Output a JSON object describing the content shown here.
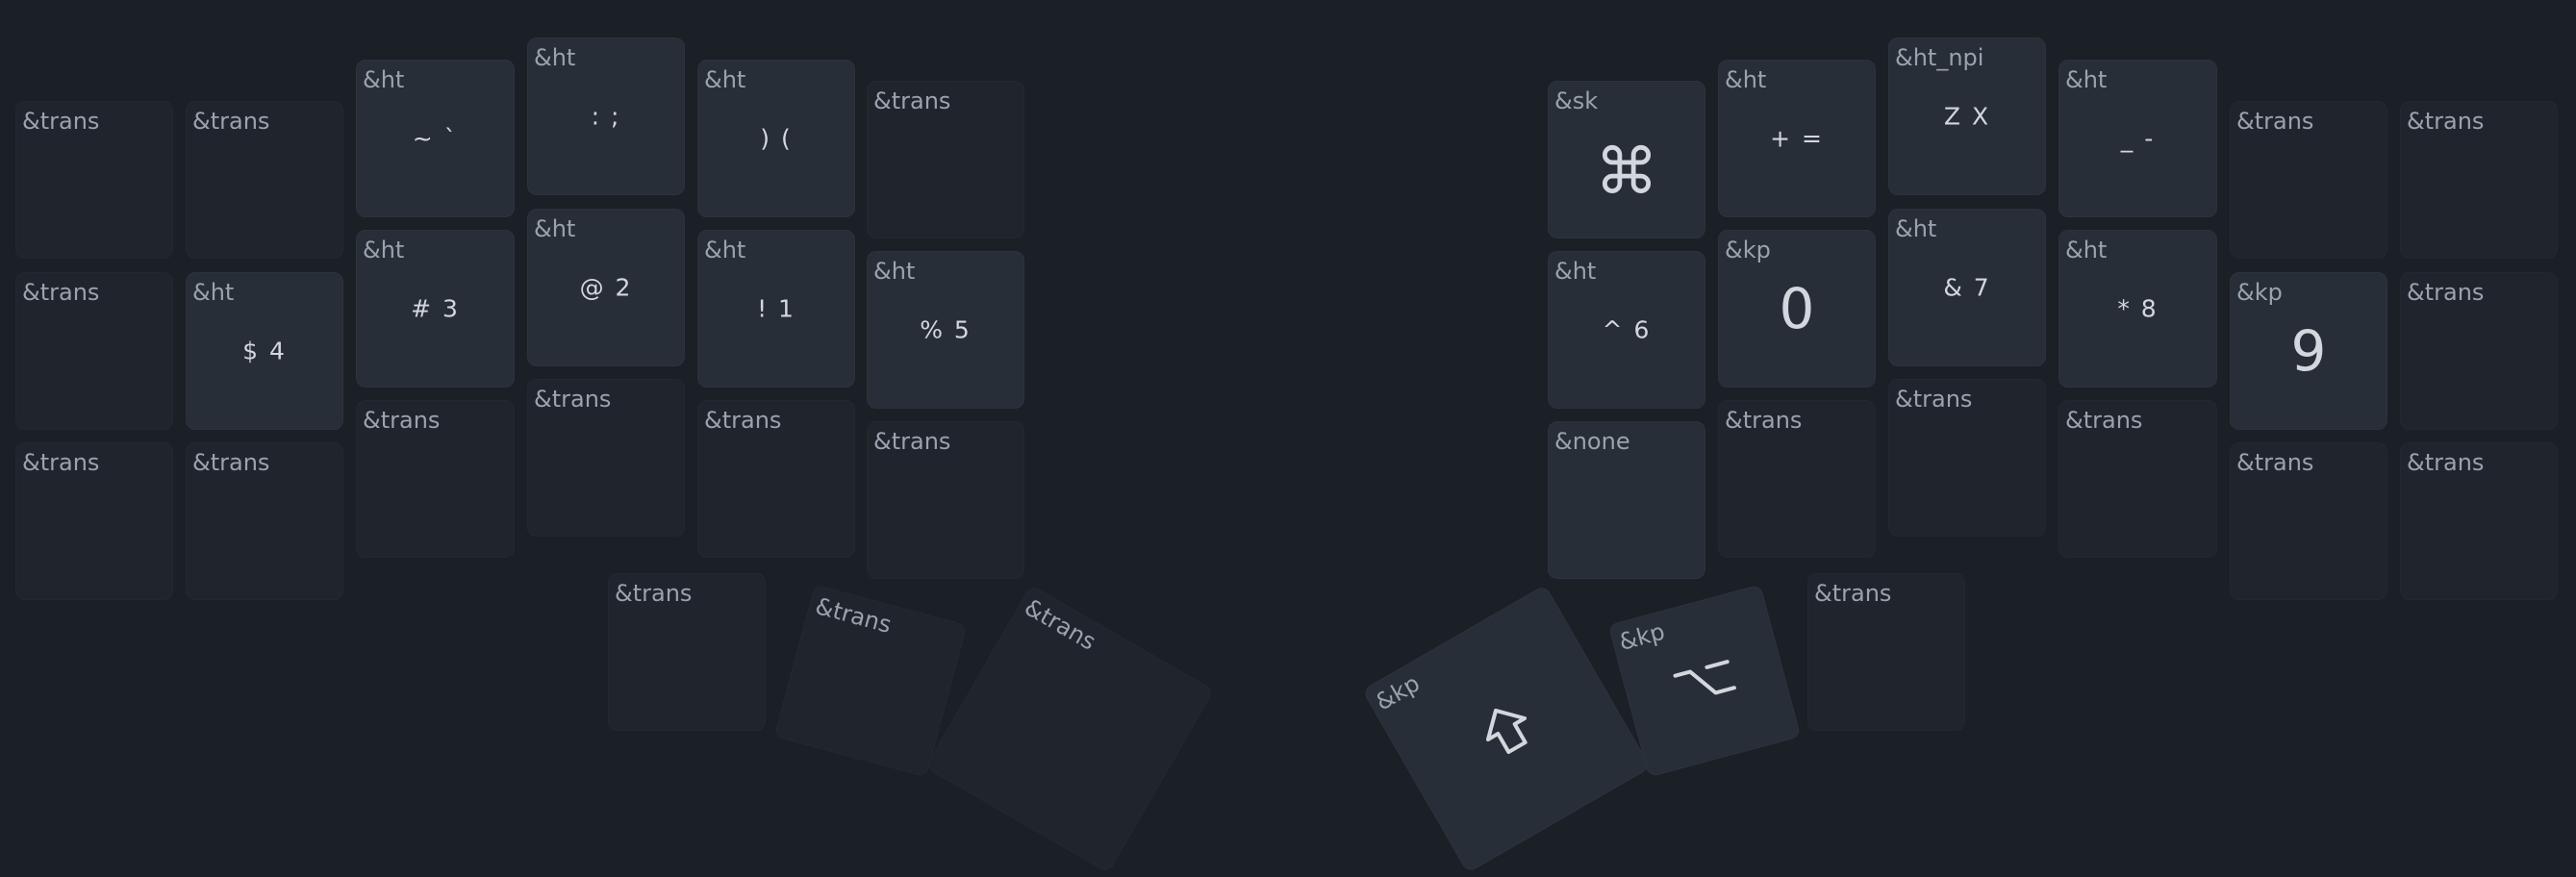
{
  "keys": [
    {
      "id": "l-r0-c0",
      "behavior": "&trans",
      "legend": ""
    },
    {
      "id": "l-r0-c1",
      "behavior": "&trans",
      "legend": ""
    },
    {
      "id": "l-r0-c2",
      "behavior": "&ht",
      "legend": "~ `"
    },
    {
      "id": "l-r0-c3",
      "behavior": "&ht",
      "legend": ": ;"
    },
    {
      "id": "l-r0-c4",
      "behavior": "&ht",
      "legend": ") ("
    },
    {
      "id": "l-r0-c5",
      "behavior": "&trans",
      "legend": ""
    },
    {
      "id": "l-r1-c0",
      "behavior": "&trans",
      "legend": ""
    },
    {
      "id": "l-r1-c1",
      "behavior": "&ht",
      "legend": "$ 4"
    },
    {
      "id": "l-r1-c2",
      "behavior": "&ht",
      "legend": "# 3"
    },
    {
      "id": "l-r1-c3",
      "behavior": "&ht",
      "legend": "@ 2"
    },
    {
      "id": "l-r1-c4",
      "behavior": "&ht",
      "legend": "! 1"
    },
    {
      "id": "l-r1-c5",
      "behavior": "&ht",
      "legend": "% 5"
    },
    {
      "id": "l-r2-c0",
      "behavior": "&trans",
      "legend": ""
    },
    {
      "id": "l-r2-c1",
      "behavior": "&trans",
      "legend": ""
    },
    {
      "id": "l-r2-c2",
      "behavior": "&trans",
      "legend": ""
    },
    {
      "id": "l-r2-c3",
      "behavior": "&trans",
      "legend": ""
    },
    {
      "id": "l-r2-c4",
      "behavior": "&trans",
      "legend": ""
    },
    {
      "id": "l-r2-c5",
      "behavior": "&trans",
      "legend": ""
    },
    {
      "id": "l-thumb-0",
      "behavior": "&trans",
      "legend": ""
    },
    {
      "id": "l-thumb-1",
      "behavior": "&trans",
      "legend": ""
    },
    {
      "id": "l-thumb-2",
      "behavior": "&trans",
      "legend": ""
    },
    {
      "id": "r-r0-c0",
      "behavior": "&sk",
      "legend": "⌘"
    },
    {
      "id": "r-r0-c1",
      "behavior": "&ht",
      "legend": "+ ="
    },
    {
      "id": "r-r0-c2",
      "behavior": "&ht_npi",
      "legend": "Z X"
    },
    {
      "id": "r-r0-c3",
      "behavior": "&ht",
      "legend": "_ -"
    },
    {
      "id": "r-r0-c4",
      "behavior": "&trans",
      "legend": ""
    },
    {
      "id": "r-r0-c5",
      "behavior": "&trans",
      "legend": ""
    },
    {
      "id": "r-r1-c0",
      "behavior": "&ht",
      "legend": "^ 6"
    },
    {
      "id": "r-r1-c1",
      "behavior": "&kp",
      "legend": "0"
    },
    {
      "id": "r-r1-c2",
      "behavior": "&ht",
      "legend": "& 7"
    },
    {
      "id": "r-r1-c3",
      "behavior": "&ht",
      "legend": "* 8"
    },
    {
      "id": "r-r1-c4",
      "behavior": "&kp",
      "legend": "9"
    },
    {
      "id": "r-r1-c5",
      "behavior": "&trans",
      "legend": ""
    },
    {
      "id": "r-r2-c0",
      "behavior": "&none",
      "legend": ""
    },
    {
      "id": "r-r2-c1",
      "behavior": "&trans",
      "legend": ""
    },
    {
      "id": "r-r2-c2",
      "behavior": "&trans",
      "legend": ""
    },
    {
      "id": "r-r2-c3",
      "behavior": "&trans",
      "legend": ""
    },
    {
      "id": "r-r2-c4",
      "behavior": "&trans",
      "legend": ""
    },
    {
      "id": "r-r2-c5",
      "behavior": "&trans",
      "legend": ""
    },
    {
      "id": "r-thumb-0",
      "behavior": "&kp",
      "legend": "",
      "icon": "shift-icon"
    },
    {
      "id": "r-thumb-1",
      "behavior": "&kp",
      "legend": "",
      "icon": "option-icon"
    },
    {
      "id": "r-thumb-2",
      "behavior": "&trans",
      "legend": ""
    }
  ]
}
